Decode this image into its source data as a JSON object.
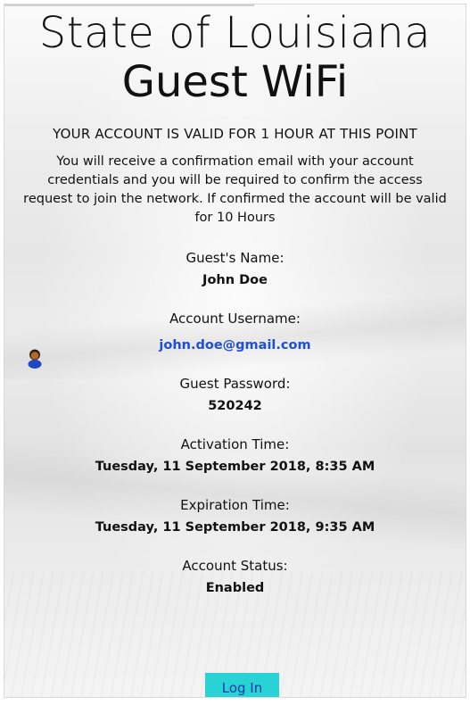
{
  "title": {
    "line1": "State of Louisiana",
    "line2": "Guest WiFi"
  },
  "notice": "YOUR ACCOUNT IS VALID FOR 1 HOUR AT THIS POINT",
  "description": "You will receive a confirmation email with your account credentials and you will be required to confirm the access request to join the network. If confirmed the account will be valid for 10 Hours",
  "fields": [
    {
      "label": "Guest's Name:",
      "value": "John Doe"
    },
    {
      "label": "Account Username:",
      "value": "john.doe@gmail.com"
    },
    {
      "label": "Guest Password:",
      "value": "520242"
    },
    {
      "label": "Activation Time:",
      "value": "Tuesday, 11 September 2018, 8:35 AM"
    },
    {
      "label": "Expiration Time:",
      "value": "Tuesday, 11 September 2018, 9:35 AM"
    },
    {
      "label": "Account Status:",
      "value": "Enabled"
    }
  ],
  "login_button": "Log In",
  "colors": {
    "button_bg": "#29d2d4",
    "button_text": "#0d3ea8",
    "email_link": "#1f4fd6"
  },
  "icons": {
    "avatar": "user-avatar-icon"
  }
}
